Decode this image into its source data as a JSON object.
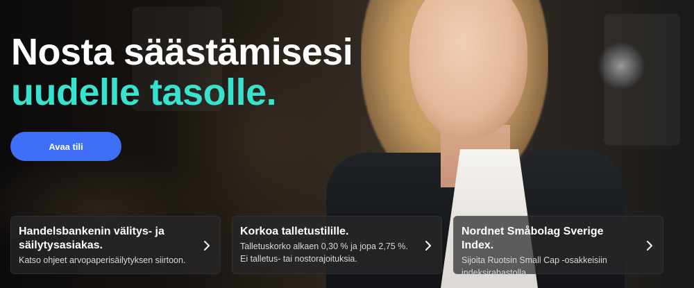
{
  "hero": {
    "headline_line1": "Nosta säästämisesi",
    "headline_line2": "uudelle tasolle.",
    "cta_label": "Avaa tili"
  },
  "cards": [
    {
      "title": "Handelsbankenin välitys- ja säilytysasiakas.",
      "description": "Katso ohjeet arvopaperisäilytyksen siirtoon.",
      "icon": "chevron-right-icon"
    },
    {
      "title": "Korkoa talletustilille.",
      "description": "Talletuskorko alkaen 0,30 % ja jopa 2,75 %. Ei talletus- tai nostorajoituksia.",
      "icon": "chevron-right-icon"
    },
    {
      "title": "Nordnet Småbolag Sverige Index.",
      "description": "Sijoita Ruotsin Small Cap -osakkeisiin indeksirahastolla.",
      "icon": "chevron-right-icon"
    }
  ],
  "colors": {
    "accent_teal": "#37e3cf",
    "button_blue": "#3f6ff6",
    "card_bg": "rgba(40,40,42,0.72)"
  }
}
